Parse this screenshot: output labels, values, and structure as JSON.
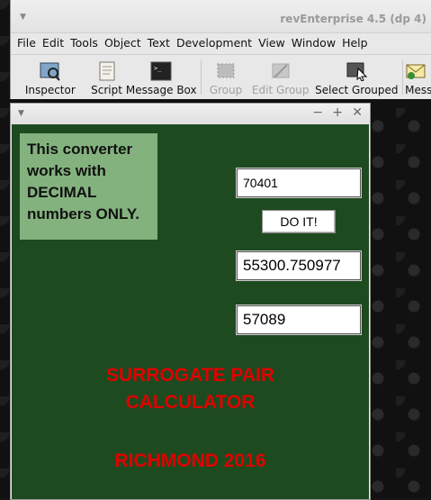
{
  "ide": {
    "title": "revEnterprise 4.5 (dp 4)",
    "menu": [
      "File",
      "Edit",
      "Tools",
      "Object",
      "Text",
      "Development",
      "View",
      "Window",
      "Help"
    ],
    "tools": [
      {
        "label": "Inspector",
        "icon": "inspector-icon",
        "enabled": true
      },
      {
        "label": "Script",
        "icon": "script-icon",
        "enabled": true
      },
      {
        "label": "Message Box",
        "icon": "message-box-icon",
        "enabled": true
      },
      {
        "label": "Group",
        "icon": "group-icon",
        "enabled": false
      },
      {
        "label": "Edit Group",
        "icon": "edit-group-icon",
        "enabled": false
      },
      {
        "label": "Select Grouped",
        "icon": "select-grouped-icon",
        "enabled": true
      },
      {
        "label": "Mess",
        "icon": "messages-icon",
        "enabled": true
      }
    ]
  },
  "stack": {
    "info": "This converter works with DECIMAL numbers ONLY.",
    "input_value": "70401",
    "button_label": "DO IT!",
    "output1": "55300.750977",
    "output2": "57089",
    "title_line1": "SURROGATE PAIR",
    "title_line2": "CALCULATOR",
    "footer": "RICHMOND 2016"
  },
  "colors": {
    "card_bg": "#1e4a20",
    "info_bg": "#83b27e",
    "accent_red": "#e00000"
  }
}
